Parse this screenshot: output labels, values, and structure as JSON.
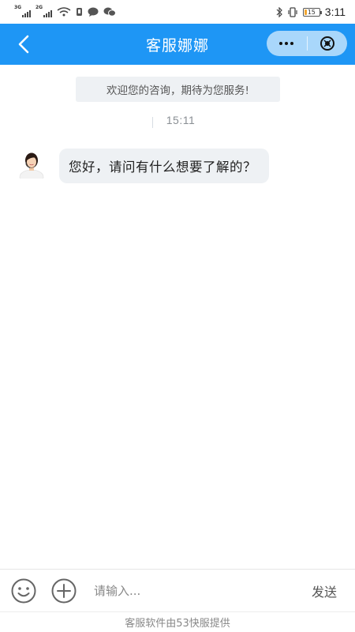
{
  "status_bar": {
    "network_1": "3G",
    "network_2": "2G",
    "battery_level": "15",
    "time": "3:11"
  },
  "header": {
    "title": "客服娜娜"
  },
  "chat": {
    "welcome": "欢迎您的咨询，期待为您服务!",
    "timestamp": "15:11",
    "messages": [
      {
        "from": "agent",
        "text": "您好，请问有什么想要了解的？"
      }
    ]
  },
  "input_bar": {
    "placeholder": "请输入...",
    "value": "",
    "send_label": "发送"
  },
  "footer": {
    "text": "客服软件由53快服提供"
  },
  "colors": {
    "accent": "#1e96f5",
    "capsule": "#a9d7fb",
    "bubble": "#eef1f4"
  }
}
